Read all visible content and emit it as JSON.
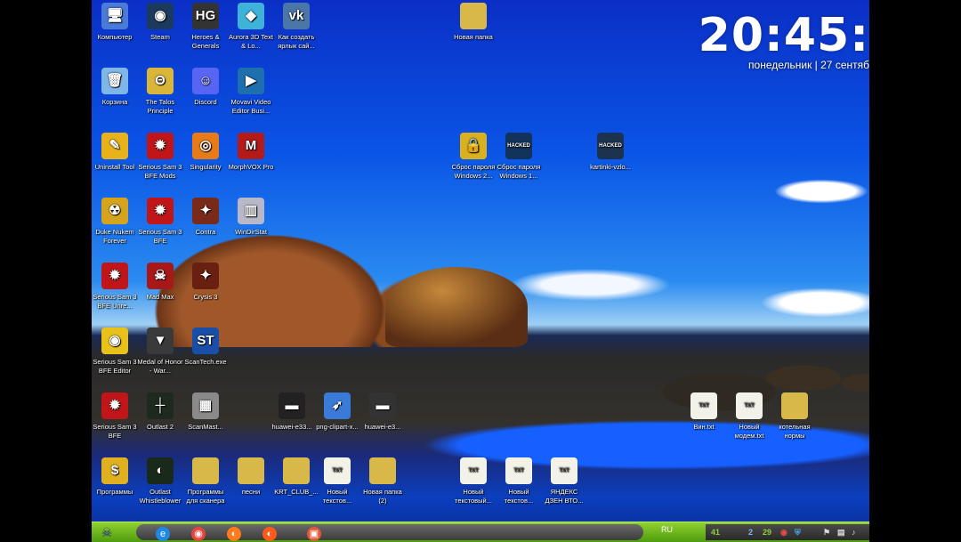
{
  "clock": {
    "time": "20:45:",
    "date": "понедельник | 27 сентяб"
  },
  "icons": [
    {
      "label": "Компьютер",
      "glyph": "🖥",
      "color": "#4a7bd8"
    },
    {
      "label": "Steam",
      "glyph": "◉",
      "color": "#1b3a5e"
    },
    {
      "label": "Heroes & Generals",
      "glyph": "HG",
      "color": "#333333"
    },
    {
      "label": "Aurora 3D Text & Lo...",
      "glyph": "◆",
      "color": "#3fb2d9"
    },
    {
      "label": "Как создать ярлык сай...",
      "glyph": "vk",
      "color": "#4a76a8"
    },
    {
      "label": "Новая папка",
      "glyph": "",
      "color": "#d9b84a"
    },
    {
      "label": "Корзина",
      "glyph": "🗑",
      "color": "#7fb6e8"
    },
    {
      "label": "The Talos Principle",
      "glyph": "Θ",
      "color": "#d9b53a"
    },
    {
      "label": "Discord",
      "glyph": "☺",
      "color": "#5865f2"
    },
    {
      "label": "Movavi Video Editor Busi...",
      "glyph": "▶",
      "color": "#1e6fae"
    },
    {
      "label": "Uninstall Tool",
      "glyph": "✎",
      "color": "#e8b21a"
    },
    {
      "label": "Serious Sam 3 BFE Mods",
      "glyph": "✹",
      "color": "#c0161a"
    },
    {
      "label": "Singularity",
      "glyph": "◎",
      "color": "#e87a18"
    },
    {
      "label": "MorphVOX Pro",
      "glyph": "M",
      "color": "#b31a1a"
    },
    {
      "label": "Сброс пароля Windows 2...",
      "glyph": "🔒",
      "color": "#d9b020"
    },
    {
      "label": "Сброс пароля Windows 1...",
      "glyph": "HACKED",
      "color": "#12335a"
    },
    {
      "label": "kartinki-vzlo...",
      "glyph": "HACKED",
      "color": "#1c3350"
    },
    {
      "label": "Duke Nukem Forever",
      "glyph": "☢",
      "color": "#d6a41c"
    },
    {
      "label": "Serious Sam 3 BFE",
      "glyph": "✹",
      "color": "#c0161a"
    },
    {
      "label": "Contra",
      "glyph": "✦",
      "color": "#7a2a18"
    },
    {
      "label": "WinDirStat",
      "glyph": "▥",
      "color": "#b8b8c8"
    },
    {
      "label": "Serious Sam 3 BFE Unre...",
      "glyph": "✹",
      "color": "#c0161a"
    },
    {
      "label": "Mad Max",
      "glyph": "☠",
      "color": "#a81818"
    },
    {
      "label": "Crysis 3",
      "glyph": "✦",
      "color": "#6a2010"
    },
    {
      "label": "Serious Sam 3 BFE Editor",
      "glyph": "◉",
      "color": "#e8c21a"
    },
    {
      "label": "Medal of Honor - War...",
      "glyph": "▼",
      "color": "#3a3a3a"
    },
    {
      "label": "ScanTech.exe",
      "glyph": "ST",
      "color": "#1a4fa8"
    },
    {
      "label": "Serious Sam 3 BFE",
      "glyph": "✹",
      "color": "#c0161a"
    },
    {
      "label": "Outlast 2",
      "glyph": "┼",
      "color": "#1e2a1e"
    },
    {
      "label": "ScanMast...",
      "glyph": "▦",
      "color": "#8a8a8a"
    },
    {
      "label": "huawei-e33...",
      "glyph": "▬",
      "color": "#222222"
    },
    {
      "label": "png-clipart-x...",
      "glyph": "➶",
      "color": "#3a7ad8"
    },
    {
      "label": "huawei-e3...",
      "glyph": "▬",
      "color": "#333333"
    },
    {
      "label": "Вин.txt",
      "glyph": "TXT",
      "color": "#f2f2e8"
    },
    {
      "label": "Новый модем.txt",
      "glyph": "TXT",
      "color": "#f2f2e8"
    },
    {
      "label": "котельная нормы",
      "glyph": "",
      "color": "#d9b84a"
    },
    {
      "label": "Программы",
      "glyph": "$",
      "color": "#e0b020"
    },
    {
      "label": "Outlast Whistleblower",
      "glyph": "◐",
      "color": "#1a2a1a"
    },
    {
      "label": "Программы для сканера",
      "glyph": "",
      "color": "#d9b84a"
    },
    {
      "label": "песни",
      "glyph": "",
      "color": "#d9b84a"
    },
    {
      "label": "KRT_CLUB_...",
      "glyph": "",
      "color": "#d9b84a"
    },
    {
      "label": "Новый текстов...",
      "glyph": "TXT",
      "color": "#f2f2e8"
    },
    {
      "label": "Новая папка (2)",
      "glyph": "",
      "color": "#d9b84a"
    },
    {
      "label": "Новый текстовый...",
      "glyph": "TXT",
      "color": "#f2f2e8"
    },
    {
      "label": "Новый текстов...",
      "glyph": "TXT",
      "color": "#f2f2e8"
    },
    {
      "label": "ЯНДЕКС ДЗЕН ВТО...",
      "glyph": "TXT",
      "color": "#f2f2e8"
    }
  ],
  "taskbar": {
    "start_glyph": "☠",
    "pinned": [
      {
        "name": "internet-explorer",
        "glyph": "e",
        "color": "#1e88e5"
      },
      {
        "name": "chrome",
        "glyph": "◉",
        "color": "#e8453c"
      },
      {
        "name": "firefox",
        "glyph": "◐",
        "color": "#ff7a1a"
      },
      {
        "name": "firefox-2",
        "glyph": "◐",
        "color": "#ff5a1a"
      },
      {
        "name": "photo-app",
        "glyph": "▣",
        "color": "#e05a3a"
      }
    ],
    "lang": "RU",
    "tray_numbers": [
      "41",
      "2",
      "29"
    ]
  }
}
